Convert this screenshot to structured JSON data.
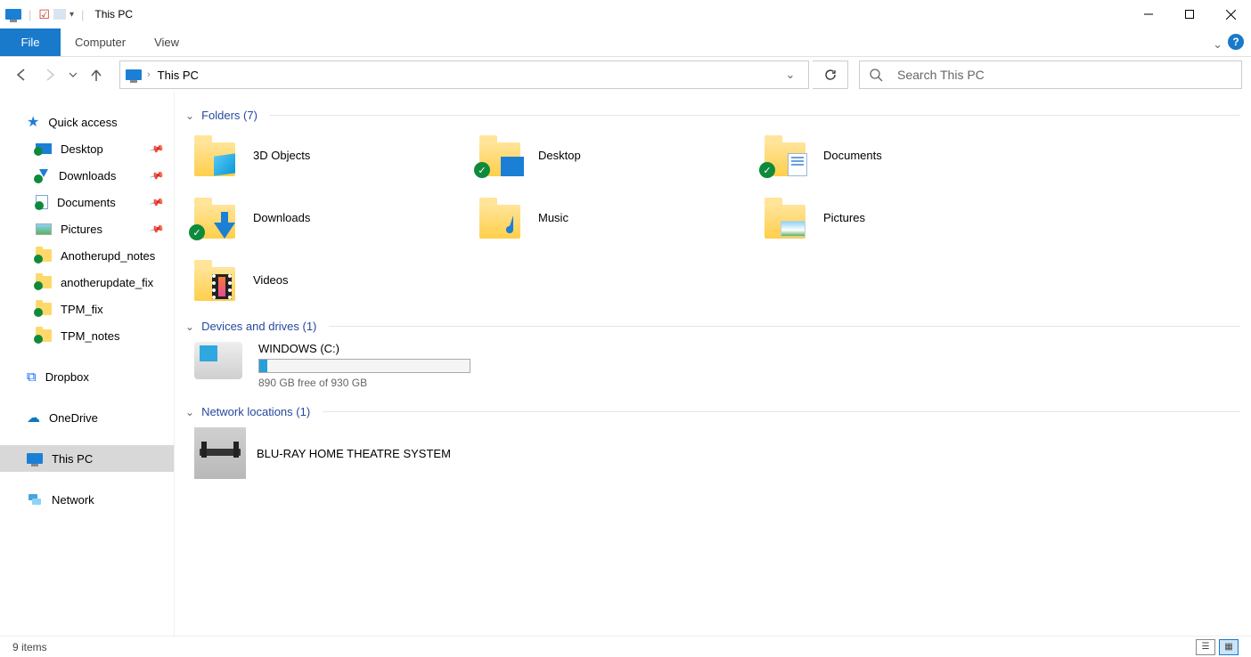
{
  "window": {
    "title": "This PC"
  },
  "ribbon": {
    "file": "File",
    "tabs": [
      "Computer",
      "View"
    ]
  },
  "nav": {
    "location": "This PC",
    "search_placeholder": "Search This PC"
  },
  "sidebar": {
    "quick_access": "Quick access",
    "quick_items": [
      {
        "label": "Desktop",
        "pinned": true
      },
      {
        "label": "Downloads",
        "pinned": true
      },
      {
        "label": "Documents",
        "pinned": true
      },
      {
        "label": "Pictures",
        "pinned": true
      },
      {
        "label": "Anotherupd_notes",
        "pinned": false
      },
      {
        "label": "anotherupdate_fix",
        "pinned": false
      },
      {
        "label": "TPM_fix",
        "pinned": false
      },
      {
        "label": "TPM_notes",
        "pinned": false
      }
    ],
    "dropbox": "Dropbox",
    "onedrive": "OneDrive",
    "this_pc": "This PC",
    "network": "Network"
  },
  "groups": {
    "folders_header": "Folders (7)",
    "drives_header": "Devices and drives (1)",
    "network_header": "Network locations (1)"
  },
  "folders": [
    {
      "label": "3D Objects"
    },
    {
      "label": "Desktop"
    },
    {
      "label": "Documents"
    },
    {
      "label": "Downloads"
    },
    {
      "label": "Music"
    },
    {
      "label": "Pictures"
    },
    {
      "label": "Videos"
    }
  ],
  "drive": {
    "label": "WINDOWS (C:)",
    "subtext": "890 GB free of 930 GB",
    "used_percent": 4
  },
  "network_loc": {
    "label": "BLU-RAY HOME THEATRE SYSTEM"
  },
  "status": {
    "items": "9 items"
  }
}
